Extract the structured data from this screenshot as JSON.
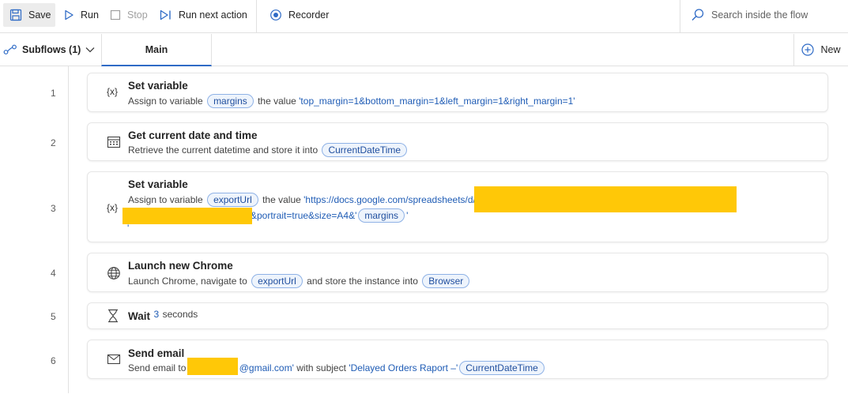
{
  "toolbar": {
    "save_label": "Save",
    "run_label": "Run",
    "stop_label": "Stop",
    "run_next_label": "Run next action",
    "recorder_label": "Recorder",
    "search_placeholder": "Search inside the flow"
  },
  "tabs": {
    "subflows_label": "Subflows (1)",
    "main_label": "Main",
    "new_label": "New"
  },
  "steps": [
    {
      "num": "1",
      "icon": "{x}",
      "title": "Set variable",
      "d1": "Assign to variable",
      "var": "margins",
      "d2": "the value",
      "value": "'top_margin=1&bottom_margin=1&left_margin=1&right_margin=1'"
    },
    {
      "num": "2",
      "icon": "calendar-icon",
      "title": "Get current date and time",
      "d1": "Retrieve the current datetime and store it into",
      "var": "CurrentDateTime"
    },
    {
      "num": "3",
      "icon": "{x}",
      "title": "Set variable",
      "d1": "Assign to variable",
      "var": "exportUrl",
      "d2": "the value",
      "value1": "'https://docs.google.com/spreadsheets/d/",
      "value2": "&portrait=true&size=A4&'",
      "var2": "margins",
      "value3": "'",
      "value4": "'"
    },
    {
      "num": "4",
      "icon": "globe-icon",
      "title": "Launch new Chrome",
      "d1": "Launch Chrome, navigate to",
      "var": "exportUrl",
      "d2": "and store the instance into",
      "var2": "Browser"
    },
    {
      "num": "5",
      "icon": "hourglass-icon",
      "title": "Wait",
      "value": "3",
      "d1": "seconds"
    },
    {
      "num": "6",
      "icon": "envelope-icon",
      "title": "Send email",
      "d1": "Send email to",
      "value": "@gmail.com'",
      "d2": "with subject",
      "value2": "'Delayed Orders Raport –'",
      "var": "CurrentDateTime"
    }
  ],
  "colors": {
    "accent": "#2f6bc6",
    "redaction": "#ffc807",
    "string_value": "#1f5cb5",
    "pill_border": "#8fb2e6"
  }
}
